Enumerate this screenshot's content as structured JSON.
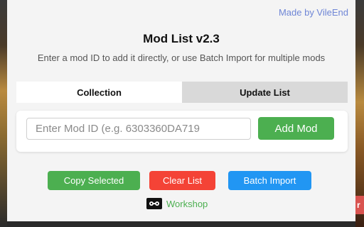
{
  "brand": {
    "made_by": "Made by VileEnd"
  },
  "header": {
    "title": "Mod List v2.3",
    "subtitle": "Enter a mod ID to add it directly, or use Batch Import for multiple mods"
  },
  "tabs": [
    {
      "label": "Collection",
      "active": true
    },
    {
      "label": "Update List",
      "active": false
    }
  ],
  "add_form": {
    "placeholder": "Enter Mod ID (e.g. 6303360DA719",
    "value": "",
    "add_label": "Add Mod"
  },
  "actions": {
    "copy_label": "Copy Selected",
    "clear_label": "Clear List",
    "batch_label": "Batch Import"
  },
  "workshop": {
    "label": "Workshop",
    "icon": "steam-workshop-icon"
  },
  "background": {
    "side_tag": "r"
  },
  "colors": {
    "accent_green": "#4caf50",
    "accent_red": "#f44336",
    "accent_blue": "#2196f3",
    "link_blue": "#6f86d6"
  }
}
